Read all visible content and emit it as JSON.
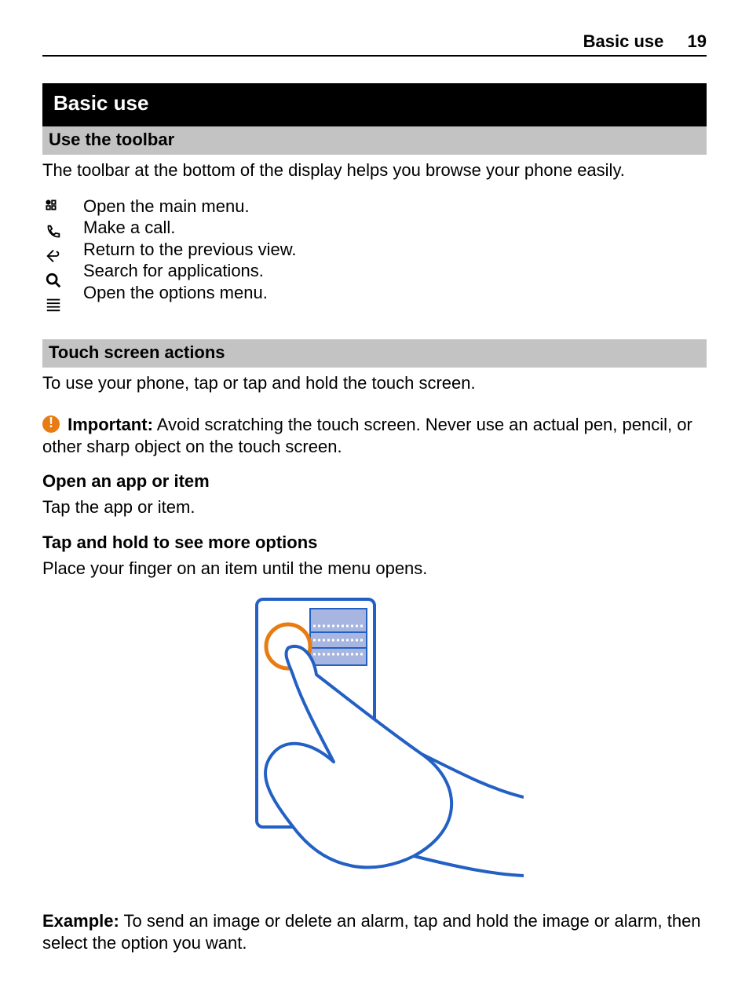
{
  "running_head": {
    "title": "Basic use",
    "page_number": "19"
  },
  "chapter": {
    "title": "Basic use"
  },
  "sections": {
    "toolbar": {
      "title": "Use the toolbar",
      "intro": "The toolbar at the bottom of the display helps you browse your phone easily.",
      "items": [
        {
          "icon": "menu-grid-icon",
          "label": "Open the main menu."
        },
        {
          "icon": "call-icon",
          "label": "Make a call."
        },
        {
          "icon": "back-arrow-icon",
          "label": "Return to the previous view."
        },
        {
          "icon": "search-icon",
          "label": "Search for applications."
        },
        {
          "icon": "options-icon",
          "label": "Open the options menu."
        }
      ]
    },
    "touch": {
      "title": "Touch screen actions",
      "intro": "To use your phone, tap or tap and hold the touch screen.",
      "important_label": "Important:",
      "important_text": " Avoid scratching the touch screen. Never use an actual pen, pencil, or other sharp object on the touch screen.",
      "open_heading": "Open an app or item",
      "open_text": "Tap the app or item.",
      "hold_heading": "Tap and hold to see more options",
      "hold_text": "Place your finger on an item until the menu opens.",
      "example_label": "Example:",
      "example_text": " To send an image or delete an alarm, tap and hold the image or alarm, then select the option you want."
    }
  }
}
